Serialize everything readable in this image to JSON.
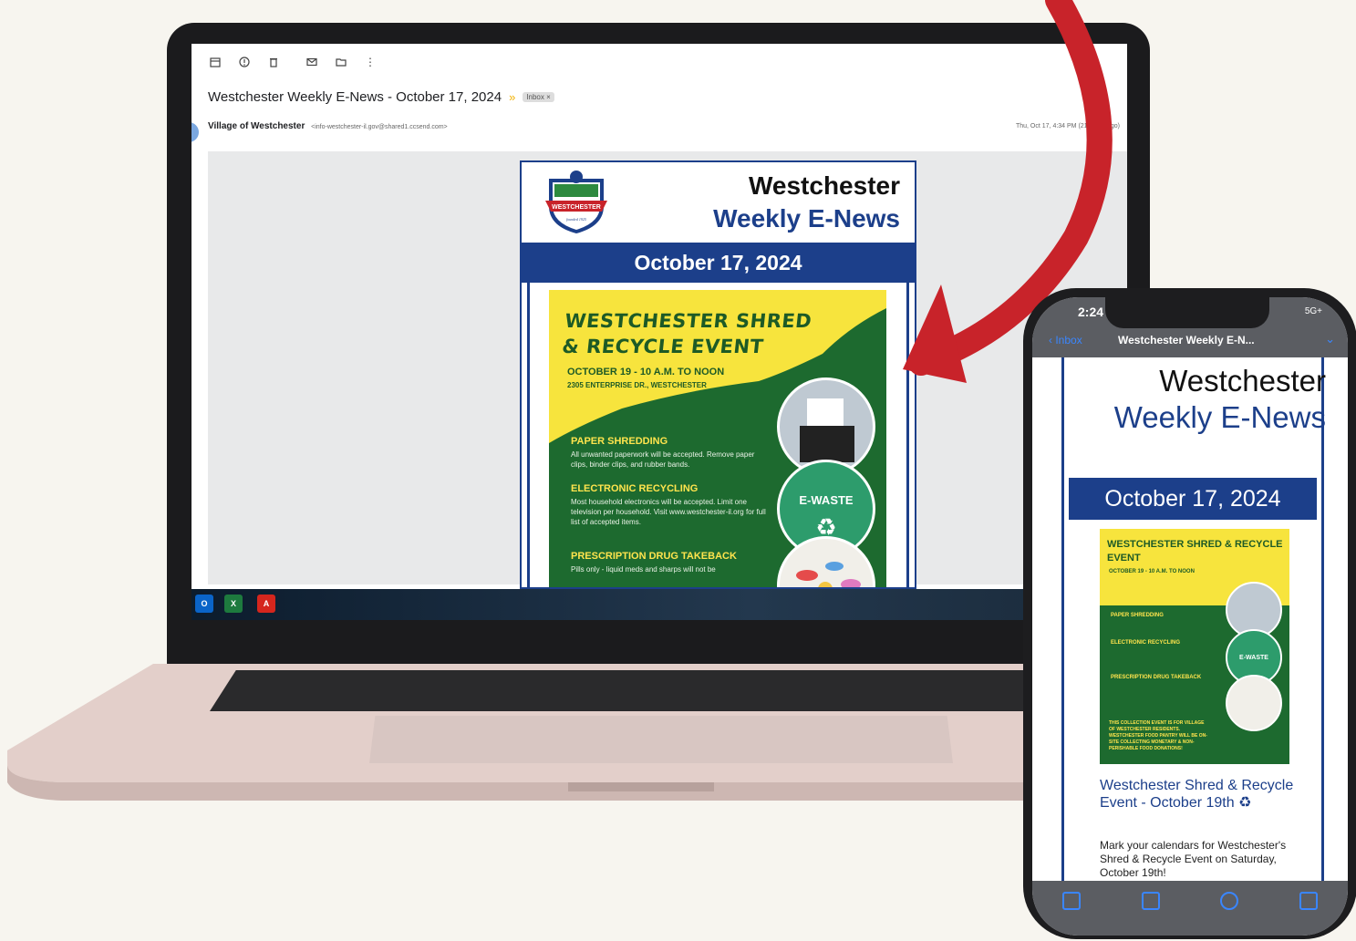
{
  "laptop": {
    "email": {
      "subject": "Westchester Weekly E-News - October 17, 2024",
      "important_marker": "»",
      "label_chip": "Inbox ×",
      "sender_name": "Village of Westchester",
      "sender_email": "<info-westchester-il.gov@shared1.ccsend.com>",
      "date": "Thu, Oct 17, 4:34 PM (21 hours ago)"
    },
    "newsletter": {
      "title_line1": "Westchester",
      "title_line2": "Weekly E-News",
      "date_band": "October 17, 2024",
      "logo_text": "WESTCHESTER",
      "logo_sub": "founded 1925"
    },
    "flyer": {
      "heading_line1": "WESTCHESTER SHRED",
      "heading_line2": "& RECYCLE EVENT",
      "when": "OCTOBER 19 - 10 A.M. TO NOON",
      "where": "2305 ENTERPRISE DR., WESTCHESTER",
      "sections": [
        {
          "title": "PAPER SHREDDING",
          "text": "All unwanted paperwork will be accepted. Remove paper clips, binder clips, and rubber bands."
        },
        {
          "title": "ELECTRONIC RECYCLING",
          "text": "Most household electronics will be accepted. Limit one television per household. Visit www.westchester-il.org for full list of accepted items."
        },
        {
          "title": "PRESCRIPTION DRUG TAKEBACK",
          "text": "Pills only - liquid meds and sharps will not be"
        }
      ],
      "ewaste_label": "E-WASTE"
    },
    "taskbar": {
      "apps": [
        "outlook-icon",
        "excel-icon",
        "acrobat-icon"
      ]
    }
  },
  "phone": {
    "time": "2:24",
    "signal": "5G+",
    "back_label": "Inbox",
    "subject": "Westchester Weekly E-N...",
    "newsletter": {
      "title_line1": "Westchester",
      "title_line2": "Weekly E-News",
      "date_band": "October 17, 2024"
    },
    "flyer": {
      "heading": "WESTCHESTER SHRED & RECYCLE EVENT",
      "when": "OCTOBER 19 - 10 A.M. TO NOON",
      "sections": [
        "PAPER SHREDDING",
        "ELECTRONIC RECYCLING",
        "PRESCRIPTION DRUG TAKEBACK"
      ],
      "footer": "THIS COLLECTION EVENT IS FOR VILLAGE OF WESTCHESTER RESIDENTS. WESTCHESTER FOOD PANTRY WILL BE ON-SITE COLLECTING MONETARY & NON-PERISHABLE FOOD DONATIONS!",
      "ewaste_label": "E-WASTE"
    },
    "story_title": "Westchester Shred & Recycle Event - October 19th ♻",
    "story_text": "Mark your calendars for Westchester's Shred & Recycle Event on Saturday, October 19th!"
  },
  "colors": {
    "navy": "#1c3f8a",
    "flyer_green": "#1d6a2f",
    "flyer_yellow": "#f7e43d",
    "arrow_red": "#c8232a",
    "ios_blue": "#3a86ff"
  }
}
